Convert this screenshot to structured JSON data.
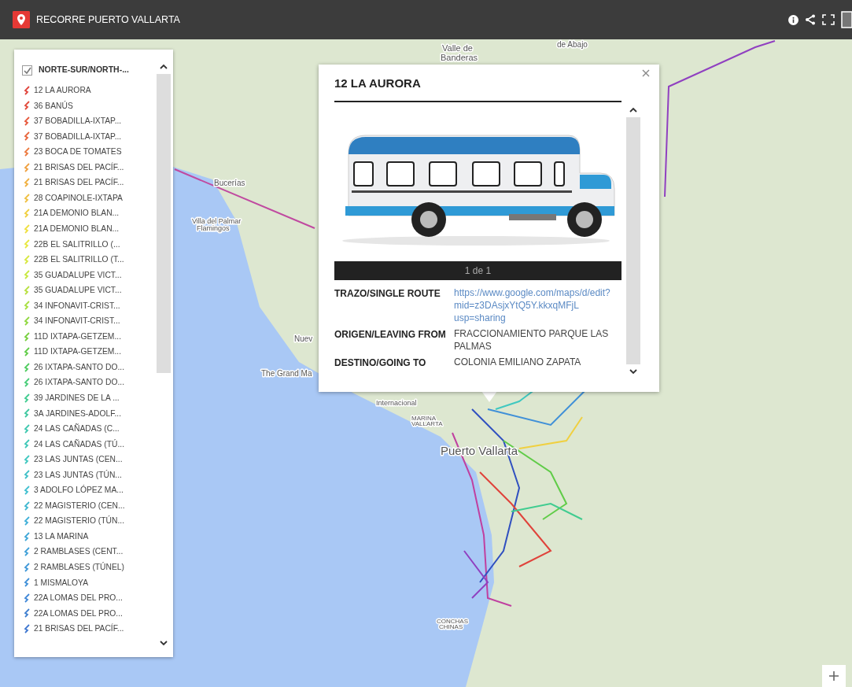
{
  "header": {
    "title": "RECORRE PUERTO VALLARTA"
  },
  "legend": {
    "layer": "NORTE-SUR/NORTH-...",
    "checked": true,
    "items": [
      {
        "label": "12 LA AURORA",
        "color": "#e0433b"
      },
      {
        "label": "36 BANÚS",
        "color": "#e24a3b"
      },
      {
        "label": "37 BOBADILLA-IXTAP...",
        "color": "#e6583c"
      },
      {
        "label": "37 BOBADILLA-IXTAP...",
        "color": "#e8663d"
      },
      {
        "label": "23 BOCA DE TOMATES",
        "color": "#ec7a40"
      },
      {
        "label": "21 BRISAS DEL PACÍF...",
        "color": "#f0a040"
      },
      {
        "label": "21 BRISAS DEL PACÍF...",
        "color": "#f0b040"
      },
      {
        "label": "28 COAPINOLE-IXTAPA",
        "color": "#f0c040"
      },
      {
        "label": "21A DEMONIO BLAN...",
        "color": "#f0d040"
      },
      {
        "label": "21A DEMONIO BLAN...",
        "color": "#f0e040"
      },
      {
        "label": "22B EL SALITRILLO (...",
        "color": "#e8e840"
      },
      {
        "label": "22B EL SALITRILLO (T...",
        "color": "#d8e840"
      },
      {
        "label": "35 GUADALUPE VICT...",
        "color": "#c8e840"
      },
      {
        "label": "35 GUADALUPE VICT...",
        "color": "#b8e040"
      },
      {
        "label": "34 INFONAVIT-CRIST...",
        "color": "#a8e040"
      },
      {
        "label": "34 INFONAVIT-CRIST...",
        "color": "#90d840"
      },
      {
        "label": "11D IXTAPA-GETZEM...",
        "color": "#78d040"
      },
      {
        "label": "11D IXTAPA-GETZEM...",
        "color": "#60cc48"
      },
      {
        "label": "26 IXTAPA-SANTO DO...",
        "color": "#50cc60"
      },
      {
        "label": "26 IXTAPA-SANTO DO...",
        "color": "#48cc78"
      },
      {
        "label": "39  JARDINES DE LA ...",
        "color": "#40cc90"
      },
      {
        "label": "3A JARDINES-ADOLF...",
        "color": "#40c8a0"
      },
      {
        "label": "24  LAS CAÑADAS (C...",
        "color": "#40c8b0"
      },
      {
        "label": "24 LAS CAÑADAS (TÚ...",
        "color": "#40c8b8"
      },
      {
        "label": "23 LAS JUNTAS (CEN...",
        "color": "#40c8c0"
      },
      {
        "label": "23 LAS JUNTAS (TÚN...",
        "color": "#40c0c8"
      },
      {
        "label": "3 ADOLFO LÓPEZ MA...",
        "color": "#40c0d0"
      },
      {
        "label": "22 MAGISTERIO (CEN...",
        "color": "#40b8d0"
      },
      {
        "label": "22 MAGISTERIO (TÚN...",
        "color": "#40b0d8"
      },
      {
        "label": "13 LA MARINA",
        "color": "#40a8d8"
      },
      {
        "label": "2 RAMBLASES (CENT...",
        "color": "#40a0d8"
      },
      {
        "label": "2 RAMBLASES (TÚNEL)",
        "color": "#4098d8"
      },
      {
        "label": "1 MISMALOYA",
        "color": "#4090d8"
      },
      {
        "label": "22A LOMAS DEL PRO...",
        "color": "#4088d8"
      },
      {
        "label": "22A LOMAS DEL PRO...",
        "color": "#4080d0"
      },
      {
        "label": "21 BRISAS DEL PACÍF...",
        "color": "#4078d0"
      }
    ]
  },
  "map": {
    "places": [
      {
        "text": "Valle de"
      },
      {
        "text": "Banderas"
      },
      {
        "text": "de Abajo"
      },
      {
        "text": "Bucerías"
      },
      {
        "text": "Villa del Palmar"
      },
      {
        "text": "Flamingos"
      },
      {
        "text": "Nuev"
      },
      {
        "text": "The Grand Ma"
      },
      {
        "text": "Internacional"
      },
      {
        "text": "MARINA"
      },
      {
        "text": "VALLARTA"
      },
      {
        "text": "Puerto Vallarta"
      },
      {
        "text": "CONCHAS"
      },
      {
        "text": "CHINAS"
      }
    ]
  },
  "popup": {
    "title": "12 LA AURORA",
    "counter": "1 de 1",
    "fields": [
      {
        "kind": "link",
        "label": "TRAZO/SINGLE ROUTE",
        "value": "https://www.google.com/maps/d/edit?mid=z3DAsjxYtQ5Y.kkxqMFjL usp=sharing"
      },
      {
        "kind": "text",
        "label": "ORIGEN/LEAVING FROM",
        "value": "FRACCIONAMIENTO  PARQUE LAS PALMAS"
      },
      {
        "kind": "text",
        "label": "DESTINO/GOING TO",
        "value": "COLONIA EMILIANO ZAPATA"
      }
    ]
  }
}
